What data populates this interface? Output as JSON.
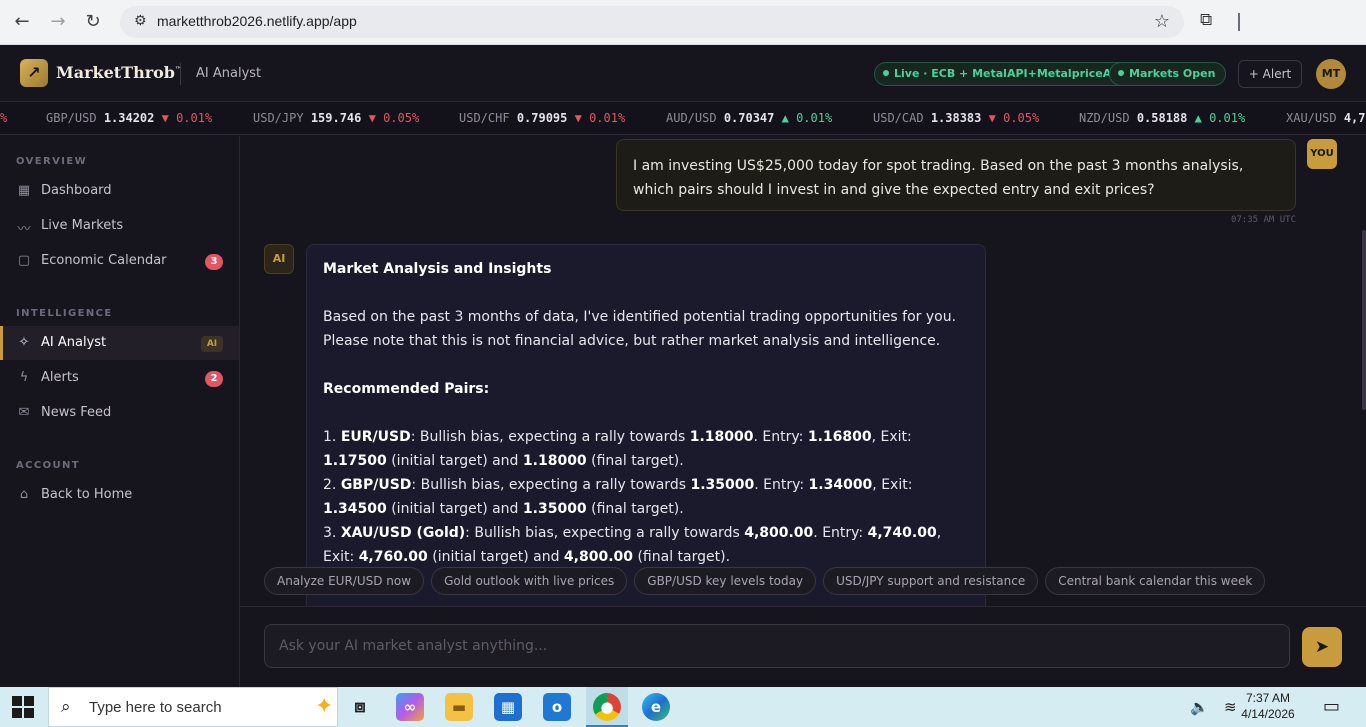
{
  "browser": {
    "url": "marketthrob2026.netlify.app/app"
  },
  "header": {
    "brand": "MarketThrob",
    "brand_tm": "™",
    "section": "AI Analyst",
    "live_status": "Live · ECB + MetalAPI+MetalpriceAPI",
    "market_status": "Markets Open",
    "alert_button": "+ Alert",
    "avatar_initials": "MT",
    "accent_color": "#c89b3c"
  },
  "ticker": [
    {
      "pair": "",
      "price": "",
      "change": "%",
      "direction": "down"
    },
    {
      "pair": "GBP/USD",
      "price": "1.34202",
      "change": "▼ 0.01%",
      "direction": "down"
    },
    {
      "pair": "USD/JPY",
      "price": "159.746",
      "change": "▼ 0.05%",
      "direction": "down"
    },
    {
      "pair": "USD/CHF",
      "price": "0.79095",
      "change": "▼ 0.01%",
      "direction": "down"
    },
    {
      "pair": "AUD/USD",
      "price": "0.70347",
      "change": "▲ 0.01%",
      "direction": "up"
    },
    {
      "pair": "USD/CAD",
      "price": "1.38383",
      "change": "▼ 0.05%",
      "direction": "down"
    },
    {
      "pair": "NZD/USD",
      "price": "0.58188",
      "change": "▲ 0.01%",
      "direction": "up"
    },
    {
      "pair": "XAU/USD",
      "price": "4,7",
      "change": "",
      "direction": "up"
    }
  ],
  "sidebar": {
    "sections": [
      "OVERVIEW",
      "INTELLIGENCE",
      "ACCOUNT"
    ],
    "items": [
      {
        "label": "Dashboard",
        "icon": "grid-icon"
      },
      {
        "label": "Live Markets",
        "icon": "trend-line-icon"
      },
      {
        "label": "Economic Calendar",
        "icon": "calendar-icon",
        "badge": "3"
      },
      {
        "label": "AI Analyst",
        "icon": "sparkle-icon",
        "badge": "AI",
        "active": true
      },
      {
        "label": "Alerts",
        "icon": "bolt-icon",
        "badge": "2"
      },
      {
        "label": "News Feed",
        "icon": "mail-icon"
      },
      {
        "label": "Back to Home",
        "icon": "home-icon"
      }
    ]
  },
  "chat": {
    "user_badge": "YOU",
    "user_message": "I am investing US$25,000 today for spot trading. Based on the past 3 months analysis, which pairs should I invest in and give the expected entry and exit prices?",
    "timestamp": "07:35 AM UTC",
    "ai_badge": "AI",
    "ai_title": "Market Analysis and Insights",
    "ai_intro": "Based on the past 3 months of data, I've identified potential trading opportunities for you. Please note that this is not financial advice, but rather market analysis and intelligence.",
    "ai_section": "Recommended Pairs:",
    "recommendations": [
      {
        "num": "1.",
        "pair": "EUR/USD",
        "text1": ": Bullish bias, expecting a rally towards ",
        "target": "1.18000",
        "entry_label": ". Entry: ",
        "entry": "1.16800",
        "exit_label": ", Exit: ",
        "exit": "1.17500",
        "mid": " (initial target) and ",
        "final": "1.18000",
        "tail": " (final target)."
      },
      {
        "num": "2.",
        "pair": "GBP/USD",
        "text1": ": Bullish bias, expecting a rally towards ",
        "target": "1.35000",
        "entry_label": ". Entry: ",
        "entry": "1.34000",
        "exit_label": ", Exit: ",
        "exit": "1.34500",
        "mid": " (initial target) and ",
        "final": "1.35000",
        "tail": " (final target)."
      },
      {
        "num": "3.",
        "pair": "XAU/USD (Gold)",
        "text1": ": Bullish bias, expecting a rally towards ",
        "target": "4,800.00",
        "entry_label": ". Entry: ",
        "entry": "4,740.00",
        "exit_label": ", Exit: ",
        "exit": "4,760.00",
        "mid": " (initial target) and ",
        "final": "4,800.00",
        "tail": " (final target)."
      }
    ]
  },
  "suggestions": [
    "Analyze EUR/USD now",
    "Gold outlook with live prices",
    "GBP/USD key levels today",
    "USD/JPY support and resistance",
    "Central bank calendar this week"
  ],
  "composer": {
    "placeholder": "Ask your AI market analyst anything..."
  },
  "taskbar": {
    "search_placeholder": "Type here to search",
    "time": "7:37 AM",
    "date": "4/14/2026"
  }
}
